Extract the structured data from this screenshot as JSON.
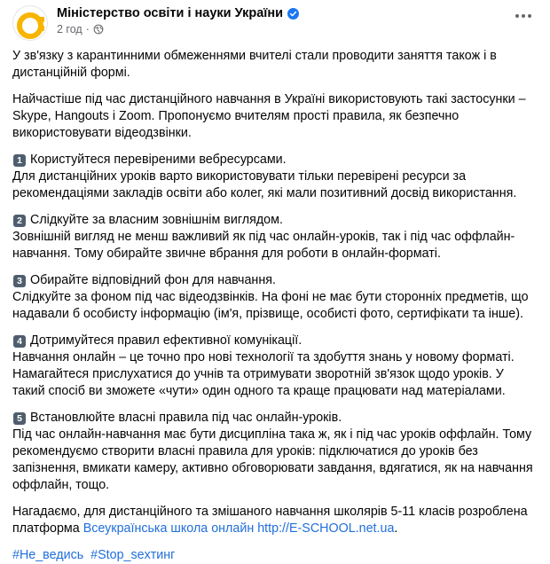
{
  "header": {
    "page_name": "Міністерство освіти і науки України",
    "time": "2 год",
    "separator": "·",
    "verified_color": "#1877f2",
    "avatar_color": "#f7b500"
  },
  "body": {
    "intro": "У зв'язку з карантинними обмеженнями вчителі стали проводити заняття також і в дистанційній формі.",
    "apps": "Найчастіше під час дистанційного навчання в Україні використовують такі застосунки – Skype, Hangouts і Zoom. Пропонуємо вчителям прості правила, як безпечно використовувати відеодзвінки.",
    "rules": [
      {
        "num": "1",
        "title": "Користуйтеся перевіреними вебресурсами.",
        "text": "Для дистанційних уроків варто використовувати тільки перевірені ресурси за рекомендаціями закладів освіти або колег, які мали позитивний досвід використання."
      },
      {
        "num": "2",
        "title": "Слідкуйте за власним зовнішнім виглядом.",
        "text": "Зовнішній вигляд не менш важливий як під час онлайн-уроків, так і під час оффлайн-навчання. Тому обирайте звичне вбрання для роботи в онлайн-форматі."
      },
      {
        "num": "3",
        "title": "Обирайте відповідний фон для навчання.",
        "text": "Слідкуйте за фоном під час відеодзвінків. На фоні не має бути сторонніх предметів, що надавали б особисту інформацію (ім'я, прізвище, особисті фото, сертифікати та інше)."
      },
      {
        "num": "4",
        "title": "Дотримуйтеся правил ефективної комунікації.",
        "text": "Навчання онлайн – це точно про нові технології та здобуття знань у новому форматі. Намагайтеся прислухатися до учнів та отримувати зворотній зв'язок щодо уроків. У такий спосіб ви зможете «чути» один одного та краще працювати над матеріалами."
      },
      {
        "num": "5",
        "title": "Встановлюйте власні правила під час онлайн-уроків.",
        "text": "Під час онлайн-навчання має бути дисципліна така ж, як і під час уроків оффлайн. Тому рекомендуємо створити власні правила для уроків: підключатися до уроків без запізнення, вмикати камеру, активно обговорювати завдання, вдягатися, як на навчання оффлайн, тощо."
      }
    ],
    "outro_text": "Нагадаємо, для дистанційного та змішаного навчання школярів 5-11 класів розроблена платформа ",
    "outro_link": "Всеукраїнська школа онлайн",
    "outro_url": "http://E-SCHOOL.net.ua",
    "outro_end": ".",
    "hashtags": [
      "#Не_ведись",
      "#Stop_sexтинг"
    ],
    "link_color": "#216fdb"
  }
}
